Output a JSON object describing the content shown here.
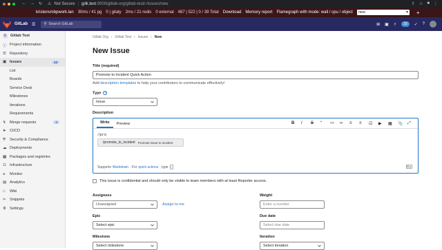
{
  "browser": {
    "security": "Not Secure",
    "host": "gdk.test",
    "path": ":3000/gitlab-org/gitlab-test/-/issues/new"
  },
  "perf": {
    "host": "kristensmbpwork.lan",
    "pg": "30ms / 41 pg",
    "gitaly": "0 | gitaly",
    "redis": "2ms / 21 redis",
    "external": "0 external",
    "mem": "487 | 522 | 0 / 39 Total",
    "download": "Download",
    "memory_report": "Memory report",
    "flamegraph": "Flamegraph with mode: wall / cpu / object",
    "select_value": "new",
    "plus": "+"
  },
  "header": {
    "app_name": "GitLab",
    "search_placeholder": "Search GitLab",
    "mr_count": "33"
  },
  "sidebar": {
    "project_initial": "G",
    "project_name": "Gitlab Test",
    "items_top": [
      {
        "label": "Project information",
        "icon": "info-icon"
      },
      {
        "label": "Repository",
        "icon": "repo-icon"
      }
    ],
    "issues": {
      "label": "Issues",
      "count": "13"
    },
    "issue_subitems": [
      "List",
      "Boards",
      "Service Desk",
      "Milestones",
      "Iterations",
      "Requirements"
    ],
    "items_bottom": [
      {
        "label": "Merge requests",
        "count": "2"
      },
      {
        "label": "CI/CD"
      },
      {
        "label": "Security & Compliance"
      },
      {
        "label": "Deployments"
      },
      {
        "label": "Packages and registries"
      },
      {
        "label": "Infrastructure"
      },
      {
        "label": "Monitor"
      },
      {
        "label": "Analytics"
      },
      {
        "label": "Wiki"
      },
      {
        "label": "Snippets"
      },
      {
        "label": "Settings"
      }
    ]
  },
  "breadcrumb": [
    "Gitlab Org",
    "Gitlab Test",
    "Issues",
    "New"
  ],
  "page": {
    "title": "New Issue",
    "title_label": "Title (required)",
    "title_value": "Promote to Incident Quick Action",
    "title_hint_pre": "Add",
    "title_hint_link": "description templates",
    "title_hint_post": "to help your contributors to communicate effectively!",
    "type_label": "Type",
    "type_value": "Issue",
    "description_label": "Description",
    "tab_write": "Write",
    "tab_preview": "Preview",
    "editor_text": "/pro",
    "autocomplete_cmd": "/promote_to_incident",
    "autocomplete_desc": "Promote issue to incident",
    "foot_pre": "Supports",
    "foot_markdown": "Markdown",
    "foot_mid": ". For",
    "foot_quick": "quick actions",
    "foot_post": ", type",
    "foot_kbd": "/",
    "confidential": "This issue is confidential and should only be visible to team members with at least Reporter access.",
    "assignees_label": "Assignees",
    "assignees_value": "Unassigned",
    "assign_to_me": "Assign to me",
    "weight_label": "Weight",
    "weight_placeholder": "Enter a number",
    "epic_label": "Epic",
    "epic_value": "Select epic",
    "due_label": "Due date",
    "due_placeholder": "Select due date",
    "milestone_label": "Milestone",
    "milestone_value": "Select milestone",
    "iteration_label": "Iteration",
    "iteration_value": "Select iteration"
  }
}
